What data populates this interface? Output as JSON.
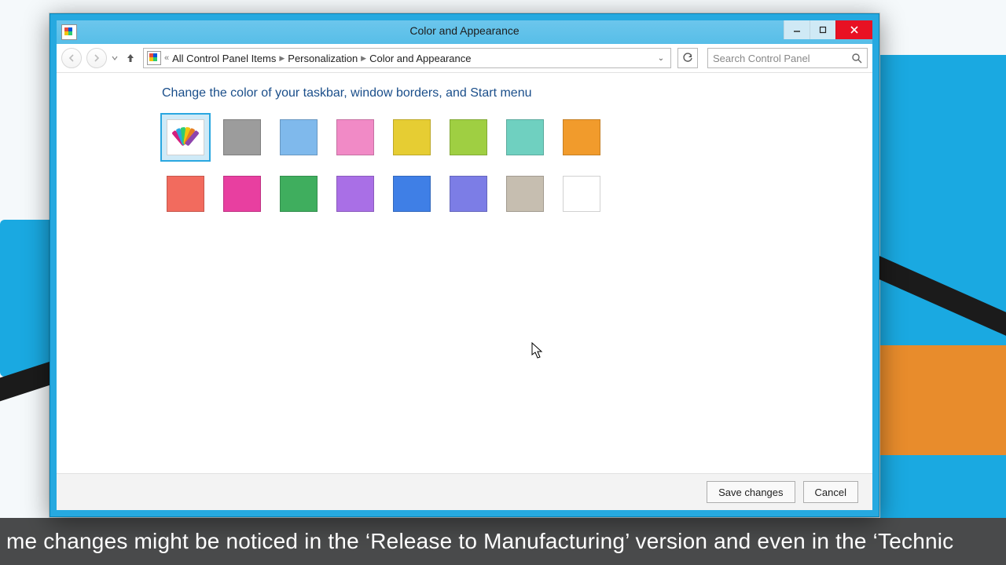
{
  "window": {
    "title": "Color and Appearance",
    "buttons": {
      "min": "–",
      "max": "▢",
      "close": "✕"
    }
  },
  "breadcrumb": {
    "lead": "«",
    "items": [
      "All Control Panel Items",
      "Personalization",
      "Color and Appearance"
    ]
  },
  "search": {
    "placeholder": "Search Control Panel"
  },
  "heading": "Change the color of your taskbar, window borders, and Start menu",
  "swatches": {
    "selected_index": 0,
    "colors": [
      "auto",
      "#9c9c9c",
      "#7fb9ec",
      "#f18ac6",
      "#e6cd33",
      "#9fcf42",
      "#6fd0c0",
      "#f19b2c",
      "#f26b5e",
      "#e83fa0",
      "#3fae5e",
      "#a96fe6",
      "#3f7fe6",
      "#7c7de6",
      "#c6beb0",
      "#ffffff"
    ]
  },
  "footer": {
    "save": "Save changes",
    "cancel": "Cancel"
  },
  "subtitle": "me changes might be noticed in the ‘Release to Manufacturing’ version and even in the ‘Technic"
}
